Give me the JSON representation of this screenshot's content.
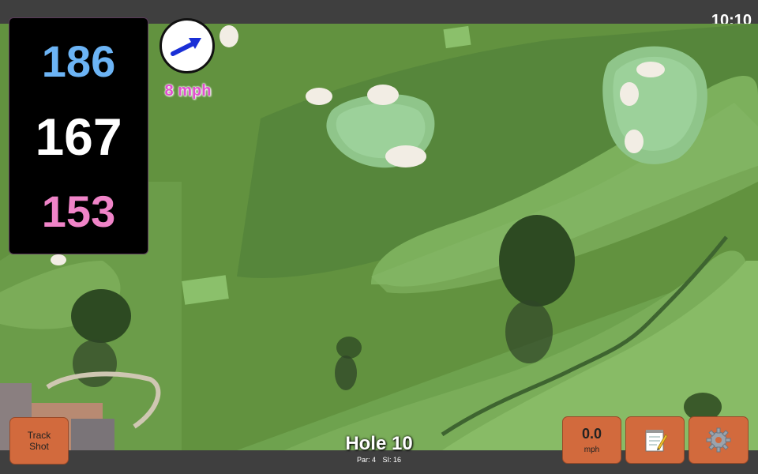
{
  "status": {
    "time": "10:10"
  },
  "distances": {
    "back": "186",
    "middle": "167",
    "front": "153"
  },
  "wind": {
    "speed": "8 mph",
    "icon": "wind-direction-arrow-icon"
  },
  "hole": {
    "title": "Hole 10",
    "par_label": "Par: 4",
    "si_label": "SI: 16"
  },
  "buttons": {
    "track_shot": {
      "line1": "Track",
      "line2": "Shot"
    },
    "speed": {
      "value": "0.0",
      "unit": "mph"
    },
    "notes": {
      "icon": "notepad-icon"
    },
    "settings": {
      "icon": "gear-icon"
    }
  },
  "colors": {
    "back_distance": "#6cb4f5",
    "middle_distance": "#ffffff",
    "front_distance": "#f084c8",
    "wind_speed": "#e24fd0",
    "button": "#d26a3d",
    "wind_arrow": "#1a2fd6"
  }
}
